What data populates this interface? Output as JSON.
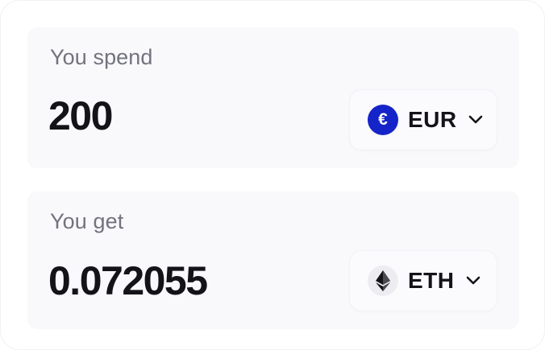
{
  "spend": {
    "label": "You spend",
    "amount": "200",
    "currency": {
      "code": "EUR",
      "symbol": "€",
      "icon": "euro-icon",
      "color": "#1424c9"
    }
  },
  "get": {
    "label": "You get",
    "amount": "0.072055",
    "currency": {
      "code": "ETH",
      "icon": "ethereum-icon",
      "color": "#131318"
    }
  },
  "colors": {
    "panel_bg": "#f9f8fb",
    "label_text": "#73737f",
    "amount_text": "#131318"
  }
}
